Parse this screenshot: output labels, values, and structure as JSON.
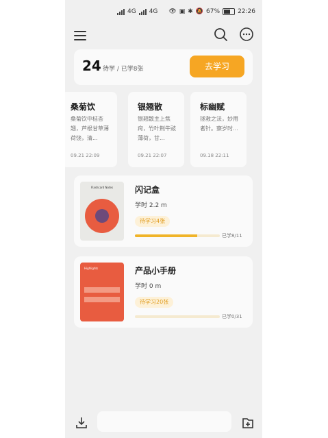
{
  "statusbar": {
    "network_left": "4G",
    "network_right": "4G",
    "battery_percent": "67%",
    "time": "22:26"
  },
  "summary": {
    "count": "24",
    "label": "待学 / 已学8张",
    "button_label": "去学习"
  },
  "word_cards": [
    {
      "title": "桑菊饮",
      "desc": "桑菊饮中桔杏翘，芦根甘草薄荷饶，清...",
      "date": "09.21 22:09"
    },
    {
      "title": "银翘散",
      "desc": "银翘散主上焦疴，竹叶荆牛豉薄荷，甘...",
      "date": "09.21 22:07"
    },
    {
      "title": "标幽赋",
      "desc": "拯救之法，妙用者针。察岁时...",
      "date": "09.18 22:11"
    }
  ],
  "notebooks": [
    {
      "title": "闪记盒",
      "time": "学时 2.2 m",
      "badge": "待学习4张",
      "progress_text": "已学8/11",
      "progress": 0.73,
      "cover_title": "Flashcard Notes",
      "cover_color": "#e85c40"
    },
    {
      "title": "产品小手册",
      "time": "学时 0 m",
      "badge": "待学习20张",
      "progress_text": "已学0/31",
      "progress": 0.0,
      "cover_title": "Highlights",
      "cover_color": "#e85c40"
    }
  ],
  "icons": {
    "menu": "menu-icon",
    "search": "search-icon",
    "more": "more-icon",
    "download": "download-icon",
    "add_folder": "add-folder-icon"
  },
  "colors": {
    "accent": "#f6a623",
    "badge_bg": "#fdf1d8",
    "badge_text": "#e09a1a",
    "progress_fill": "#f0b429"
  }
}
